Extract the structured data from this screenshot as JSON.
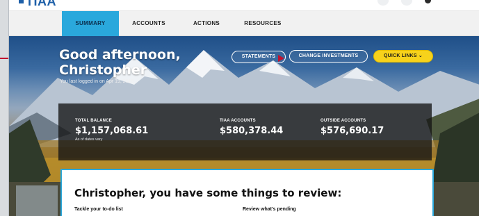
{
  "app": {
    "logo_text": "TIAA"
  },
  "nav": {
    "items": [
      {
        "label": "SUMMARY",
        "active": true
      },
      {
        "label": "ACCOUNTS",
        "active": false
      },
      {
        "label": "ACTIONS",
        "active": false
      },
      {
        "label": "RESOURCES",
        "active": false
      }
    ]
  },
  "hero": {
    "greeting_line1": "Good afternoon,",
    "greeting_line2": "Christopher",
    "last_login": "You last logged in on Apr 19, 2018"
  },
  "actions": {
    "statements": "STATEMENTS",
    "change_investments": "CHANGE INVESTMENTS",
    "quick_links": "QUICK LINKS",
    "quick_links_icon": "chevron-down-icon"
  },
  "balances": {
    "total_label": "TOTAL BALANCE",
    "total_value": "$1,157,068.61",
    "total_note": "As of dates vary",
    "tiaa_label": "TIAA ACCOUNTS",
    "tiaa_value": "$580,378.44",
    "outside_label": "OUTSIDE ACCOUNTS",
    "outside_value": "$576,690.17"
  },
  "review": {
    "title": "Christopher, you have some things to review:",
    "todo_heading": "Tackle your to-do list",
    "pending_heading": "Review what's pending"
  },
  "colors": {
    "accent": "#2aa8dc",
    "quick_links_yellow": "#f7d21b",
    "pointer_red": "#c1122f"
  }
}
